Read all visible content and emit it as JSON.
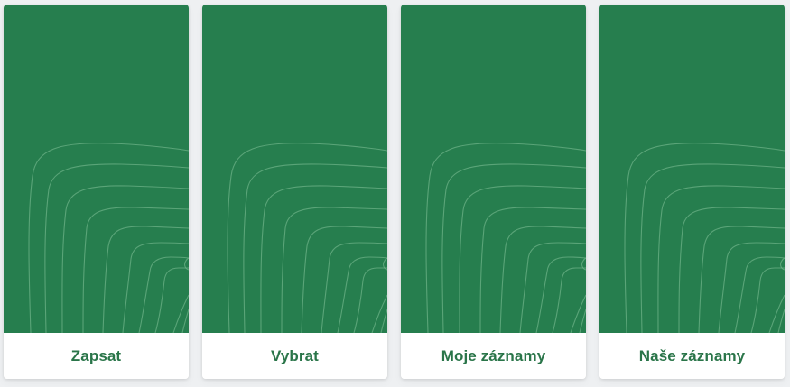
{
  "colors": {
    "page_background": "#eef0f2",
    "card_green": "#267e4e",
    "contour_line": "#6cb287",
    "label_green": "#2a7549",
    "footer_background": "#ffffff"
  },
  "cards": [
    {
      "label": "Zapsat",
      "icon": "contour-pattern-icon"
    },
    {
      "label": "Vybrat",
      "icon": "contour-pattern-icon"
    },
    {
      "label": "Moje záznamy",
      "icon": "contour-pattern-icon"
    },
    {
      "label": "Naše záznamy",
      "icon": "contour-pattern-icon"
    }
  ]
}
